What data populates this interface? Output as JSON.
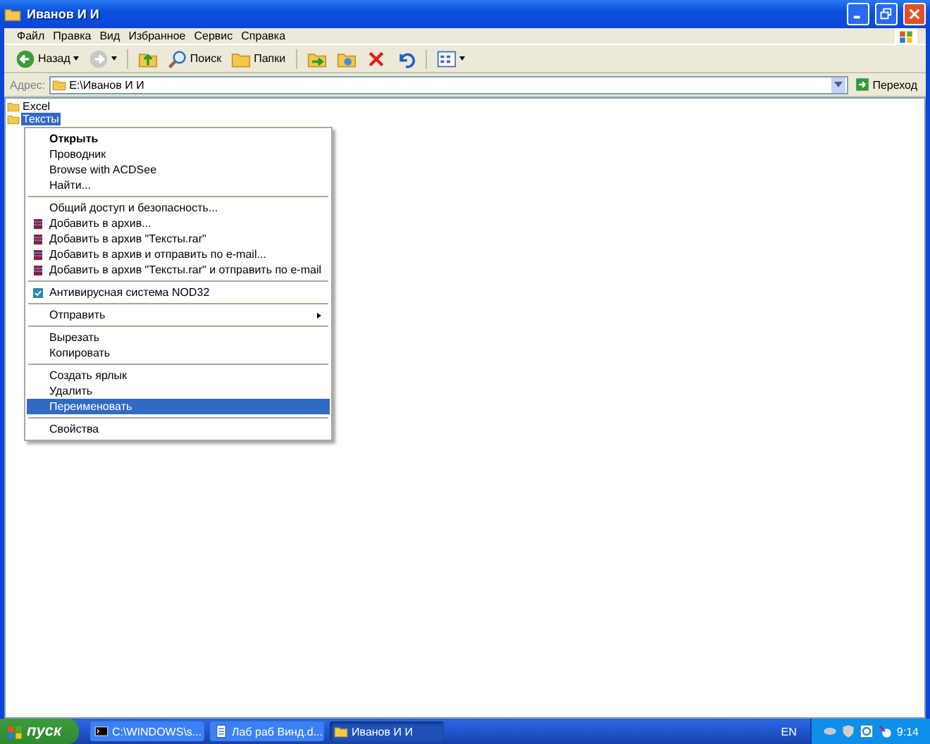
{
  "window": {
    "title": "Иванов И И"
  },
  "menu_bar": [
    "Файл",
    "Правка",
    "Вид",
    "Избранное",
    "Сервис",
    "Справка"
  ],
  "toolbar": [
    {
      "kind": "back",
      "label": "Назад"
    },
    {
      "kind": "forward"
    },
    {
      "kind": "up"
    },
    {
      "kind": "search",
      "label": "Поиск"
    },
    {
      "kind": "folders",
      "label": "Папки"
    },
    {
      "kind": "move"
    },
    {
      "kind": "copy"
    },
    {
      "kind": "delete"
    },
    {
      "kind": "undo"
    },
    {
      "kind": "views"
    }
  ],
  "address_bar": {
    "label": "Адрес:",
    "value": "E:\\Иванов И И",
    "go_button": "Переход"
  },
  "files": [
    {
      "name": "Excel",
      "selected": false
    },
    {
      "name": "Тексты",
      "selected": true
    }
  ],
  "context_menu": [
    {
      "kind": "item",
      "label": "Открыть",
      "default": true,
      "selected": false
    },
    {
      "kind": "item",
      "label": "Проводник",
      "default": false,
      "selected": false
    },
    {
      "kind": "item",
      "label": "Browse with ACDSee",
      "default": false,
      "selected": false
    },
    {
      "kind": "item",
      "label": "Найти...",
      "default": false,
      "selected": false
    },
    {
      "kind": "separator"
    },
    {
      "kind": "item",
      "label": "Общий доступ и безопасность...",
      "default": false,
      "selected": false
    },
    {
      "kind": "archive",
      "label": "Добавить в архив...",
      "default": false,
      "selected": false
    },
    {
      "kind": "archive",
      "label": "Добавить в архив \"Тексты.rar\"",
      "default": false,
      "selected": false
    },
    {
      "kind": "archive",
      "label": "Добавить в архив и отправить по e-mail...",
      "default": false,
      "selected": false
    },
    {
      "kind": "archive",
      "label": "Добавить в архив \"Тексты.rar\" и отправить по e-mail",
      "default": false,
      "selected": false
    },
    {
      "kind": "separator"
    },
    {
      "kind": "antivirus",
      "label": "Антивирусная система NOD32",
      "default": false,
      "selected": false
    },
    {
      "kind": "separator"
    },
    {
      "kind": "submenu",
      "label": "Отправить",
      "default": false,
      "selected": false
    },
    {
      "kind": "separator"
    },
    {
      "kind": "item",
      "label": "Вырезать",
      "default": false,
      "selected": false
    },
    {
      "kind": "item",
      "label": "Копировать",
      "default": false,
      "selected": false
    },
    {
      "kind": "separator"
    },
    {
      "kind": "item",
      "label": "Создать ярлык",
      "default": false,
      "selected": false
    },
    {
      "kind": "item",
      "label": "Удалить",
      "default": false,
      "selected": false
    },
    {
      "kind": "item",
      "label": "Переименовать",
      "default": false,
      "selected": true
    },
    {
      "kind": "separator"
    },
    {
      "kind": "item",
      "label": "Свойства",
      "default": false,
      "selected": false
    }
  ],
  "taskbar": {
    "start_button": "пуск",
    "tasks": [
      {
        "kind": "console",
        "label": "C:\\WINDOWS\\s...",
        "selected": false
      },
      {
        "kind": "document",
        "label": "Лаб раб Винд.d...",
        "selected": false
      },
      {
        "kind": "folder",
        "label": "Иванов И И",
        "selected": true
      }
    ],
    "language": "EN",
    "clock": "9:14"
  }
}
